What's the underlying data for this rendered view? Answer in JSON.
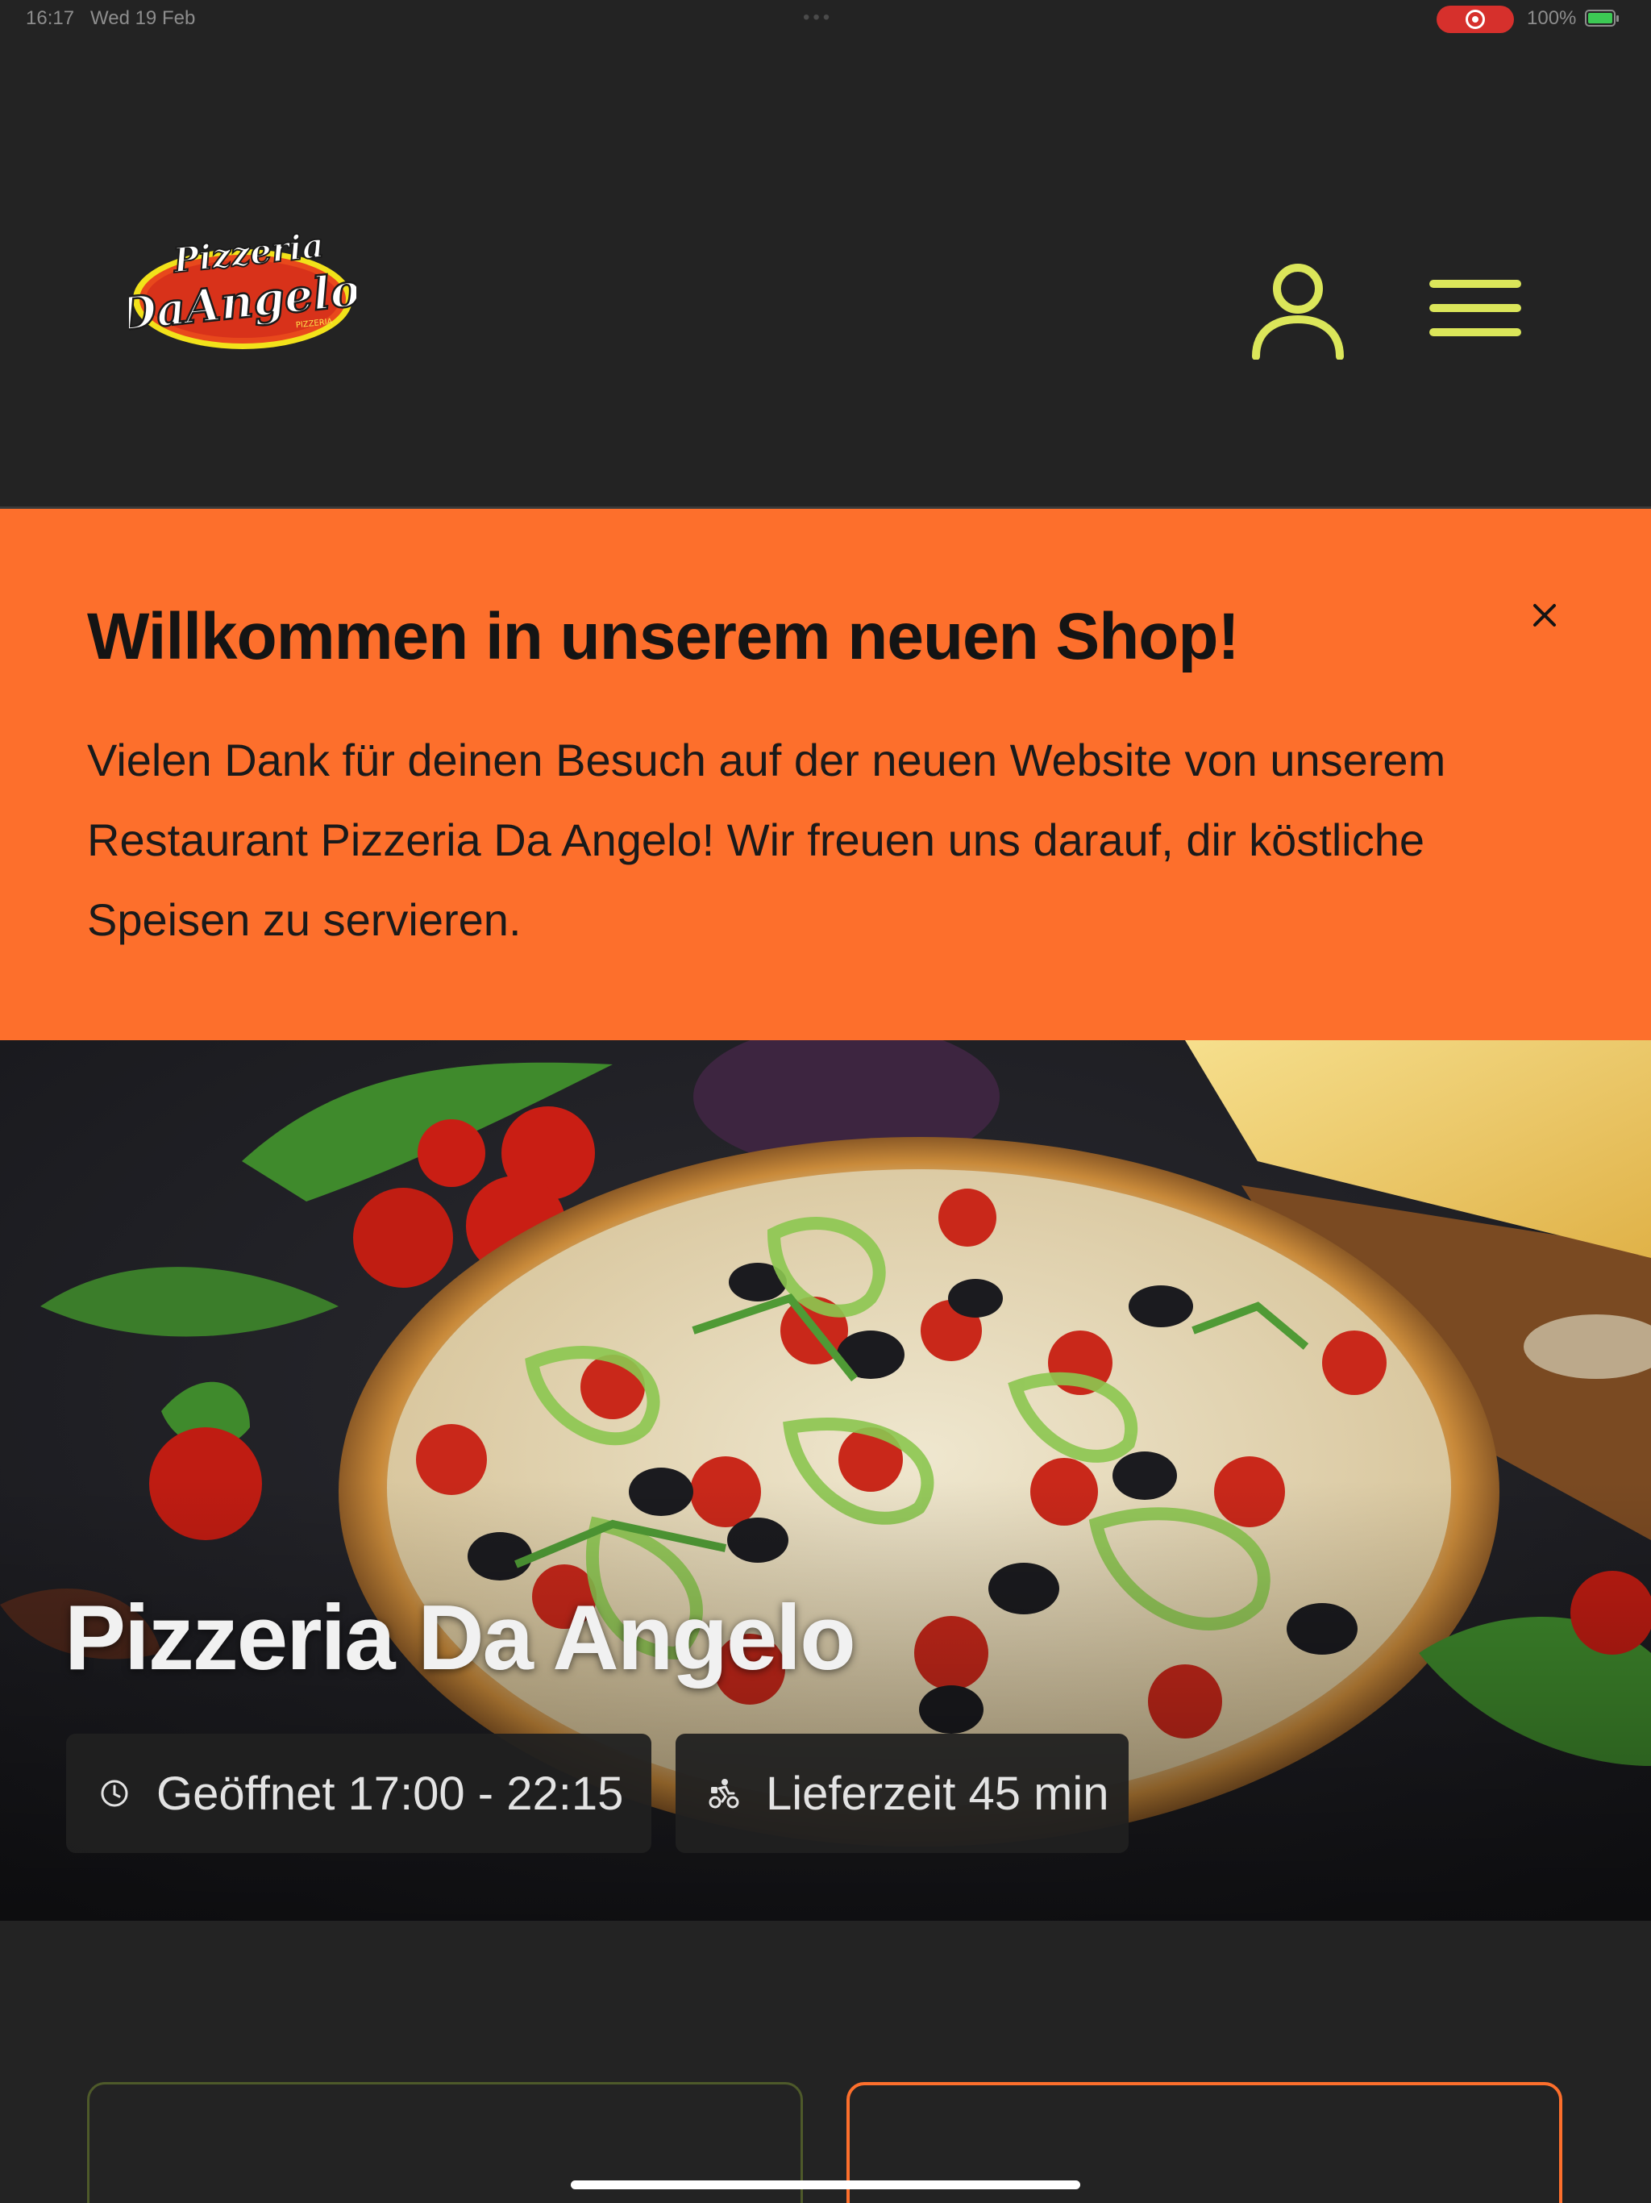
{
  "status_bar": {
    "time": "16:17",
    "date": "Wed 19 Feb",
    "battery": "100%"
  },
  "header": {
    "logo_text_top": "Pizzeria",
    "logo_text_bottom": "DaAngelo",
    "logo_subtext": "PIZZERIA",
    "user_icon": "user-icon",
    "menu_icon": "hamburger-menu-icon",
    "accent_color": "#dbe65a"
  },
  "banner": {
    "title": "Willkommen in unserem neuen Shop!",
    "text": "Vielen Dank für deinen Besuch auf der neuen Website von unserem Restaurant Pizzeria Da Angelo! Wir freuen uns darauf, dir köstliche Speisen zu servieren.",
    "background_color": "#fd6f2c",
    "close_icon": "close-icon"
  },
  "hero": {
    "restaurant_name": "Pizzeria Da Angelo",
    "opening_label": "Geöffnet 17:00 - 22:15",
    "delivery_label": "Lieferzeit 45 min",
    "opening_icon": "clock-icon",
    "delivery_icon": "bike-delivery-icon"
  }
}
